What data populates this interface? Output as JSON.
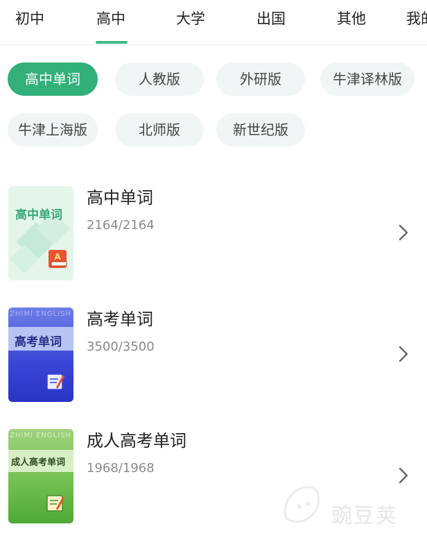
{
  "tabs": [
    {
      "label": "初中"
    },
    {
      "label": "高中"
    },
    {
      "label": "大学"
    },
    {
      "label": "出国"
    },
    {
      "label": "其他"
    },
    {
      "label": "我的"
    }
  ],
  "active_tab": "高中",
  "chips": [
    {
      "label": "高中单词"
    },
    {
      "label": "人教版"
    },
    {
      "label": "外研版"
    },
    {
      "label": "牛津译林版"
    },
    {
      "label": "牛津上海版"
    },
    {
      "label": "北师版"
    },
    {
      "label": "新世纪版"
    }
  ],
  "active_chip": "高中单词",
  "books": [
    {
      "title": "高中单词",
      "count": "2164/2164",
      "cover_text": "高中单词",
      "cover_icon": "book-a-icon"
    },
    {
      "title": "高考单词",
      "count": "3500/3500",
      "cover_text": "高考单词",
      "cover_top_text": "ZHIMI ENGLISH",
      "cover_icon": "scroll-pen-icon"
    },
    {
      "title": "成人高考单词",
      "count": "1968/1968",
      "cover_text": "成人高考单词",
      "cover_top_text": "ZHIMI ENGLISH",
      "cover_icon": "scroll-pen-icon"
    }
  ],
  "watermark": "豌豆荚",
  "colors": {
    "accent": "#33b07a",
    "chip_bg": "#f1f5f6",
    "text_primary": "#222222",
    "text_secondary": "#8a8a8a"
  }
}
